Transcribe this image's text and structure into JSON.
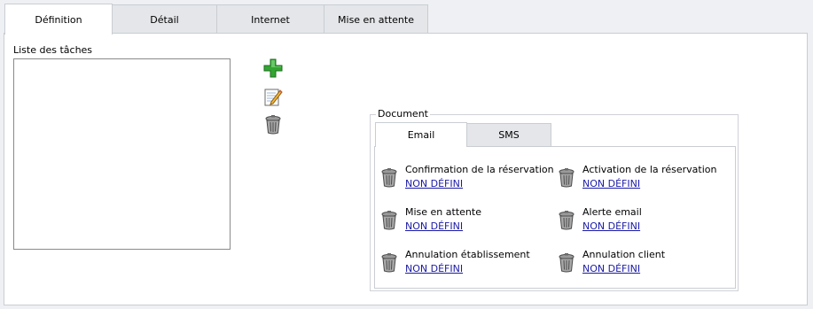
{
  "tabs": [
    "Définition",
    "Détail",
    "Internet",
    "Mise en attente"
  ],
  "active_tab": "Définition",
  "tasks": {
    "label": "Liste des tâches",
    "items": [],
    "tools": [
      "add-icon",
      "edit-icon",
      "trash-icon"
    ]
  },
  "document": {
    "legend": "Document",
    "tabs": [
      "Email",
      "SMS"
    ],
    "active_tab": "Email",
    "items": [
      {
        "title": "Confirmation de la réservation",
        "value": "NON DÉFINI"
      },
      {
        "title": "Activation de la réservation",
        "value": "NON DÉFINI"
      },
      {
        "title": "Mise en attente",
        "value": "NON DÉFINI"
      },
      {
        "title": "Alerte email",
        "value": "NON DÉFINI"
      },
      {
        "title": "Annulation établissement",
        "value": "NON DÉFINI"
      },
      {
        "title": "Annulation client",
        "value": "NON DÉFINI"
      }
    ]
  },
  "colors": {
    "accent_green": "#2e9e2e",
    "link_blue": "#1a1aa6",
    "border": "#c9cdd2"
  }
}
